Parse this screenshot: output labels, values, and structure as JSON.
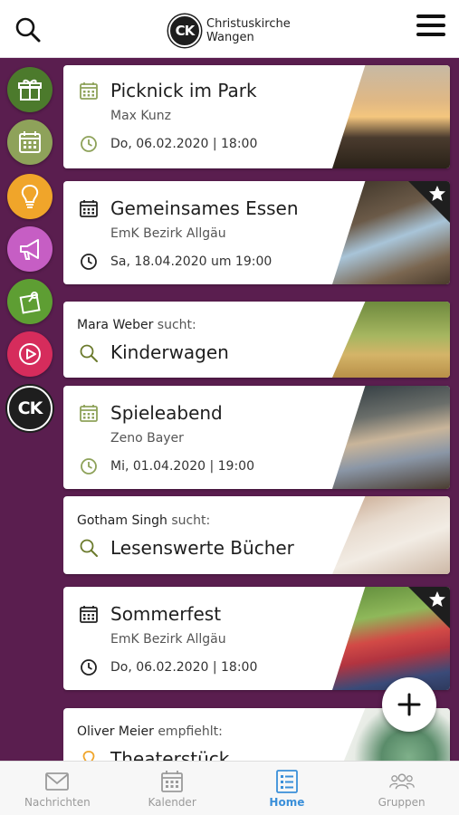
{
  "header": {
    "logo_letters": "CK",
    "brand_line1": "Christuskirche",
    "brand_line2": "Wangen",
    "search_icon": "search-icon",
    "menu_icon": "hamburger-menu-icon"
  },
  "sidebar": {
    "items": [
      {
        "name": "gift",
        "icon": "gift-icon",
        "color": "#4c7a2c"
      },
      {
        "name": "calendar",
        "icon": "calendar-icon",
        "color": "#8ea25a"
      },
      {
        "name": "idea",
        "icon": "lightbulb-icon",
        "color": "#f0a52a"
      },
      {
        "name": "announce",
        "icon": "megaphone-icon",
        "color": "#c65ec4"
      },
      {
        "name": "share",
        "icon": "pin-note-icon",
        "color": "#5e9e33"
      },
      {
        "name": "media",
        "icon": "play-icon",
        "color": "#d62c5c"
      },
      {
        "name": "church",
        "icon": "ck-logo-icon",
        "color": "#1e1e1e",
        "label": "CK"
      }
    ]
  },
  "feed": {
    "cards": [
      {
        "type": "event",
        "title": "Picknick im Park",
        "subtitle": "Max Kunz",
        "date": "Do, 06.02.2020 | 18:00",
        "starred": false,
        "icon_color": "#8ea25a",
        "photo": "park-sunset-photo"
      },
      {
        "type": "event",
        "title": "Gemeinsames Essen",
        "subtitle": "EmK Bezirk Allgäu",
        "date": "Sa, 18.04.2020 um 19:00",
        "starred": true,
        "icon_color": "#222222",
        "photo": "friends-dinner-photo"
      },
      {
        "type": "request",
        "name": "Mara Weber",
        "verb": "sucht:",
        "title": "Kinderwagen",
        "icon_color": "#6b7a2c",
        "photo": "family-walk-photo"
      },
      {
        "type": "event",
        "title": "Spieleabend",
        "subtitle": "Zeno Bayer",
        "date": "Mi, 01.04.2020 | 19:00",
        "starred": false,
        "icon_color": "#8ea25a",
        "photo": "chess-game-photo"
      },
      {
        "type": "request",
        "name": "Gotham Singh",
        "verb": "sucht:",
        "title": "Lesenswerte Bücher",
        "icon_color": "#6b7a2c",
        "photo": "open-book-photo"
      },
      {
        "type": "event",
        "title": "Sommerfest",
        "subtitle": "EmK Bezirk Allgäu",
        "date": "Do, 06.02.2020 | 18:00",
        "starred": true,
        "icon_color": "#222222",
        "photo": "fruit-jar-photo"
      },
      {
        "type": "recommendation",
        "name": "Oliver Meier",
        "verb": "empfiehlt:",
        "title": "Theaterstück",
        "icon_color": "#f0a52a",
        "photo": "succulent-photo"
      }
    ]
  },
  "fab": {
    "icon": "plus-icon"
  },
  "tabbar": {
    "tabs": [
      {
        "label": "Nachrichten",
        "icon": "envelope-icon",
        "active": false
      },
      {
        "label": "Kalender",
        "icon": "calendar-icon",
        "active": false
      },
      {
        "label": "Home",
        "icon": "list-icon",
        "active": true
      },
      {
        "label": "Gruppen",
        "icon": "group-icon",
        "active": false
      }
    ]
  },
  "colors": {
    "background": "#5a1e4f",
    "tab_active": "#3a8fd9",
    "tab_inactive": "#9a9a9a"
  }
}
